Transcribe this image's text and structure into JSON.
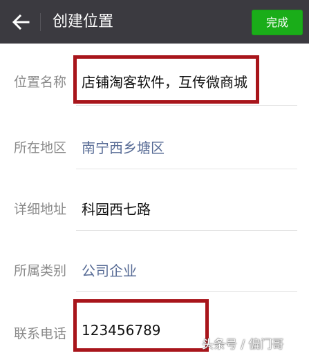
{
  "header": {
    "title": "创建位置",
    "done_label": "完成",
    "colors": {
      "bar": "#3b3a40",
      "done": "#1aad19"
    }
  },
  "form": {
    "rows": [
      {
        "label": "位置名称",
        "value": "店铺淘客软件，互传微商城"
      },
      {
        "label": "所在地区",
        "value": "南宁西乡塘区"
      },
      {
        "label": "详细地址",
        "value": "科园西七路"
      },
      {
        "label": "所属类别",
        "value": "公司企业"
      },
      {
        "label": "联系电话",
        "value": "123456789"
      }
    ]
  },
  "watermark": "头条号 / 偏门哥",
  "icons": {
    "back": "arrow-left-icon"
  },
  "colors": {
    "highlight": "#a8151b",
    "link": "#576b95",
    "label": "#8a8a8a"
  }
}
